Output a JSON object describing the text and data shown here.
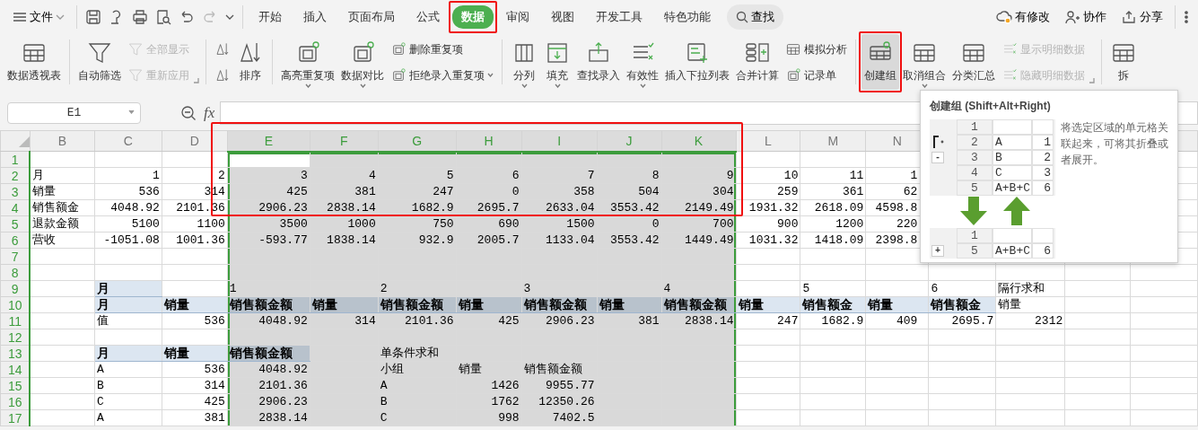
{
  "menu": {
    "label": "文件"
  },
  "tabs": [
    {
      "label": "开始",
      "selected": false
    },
    {
      "label": "插入",
      "selected": false
    },
    {
      "label": "页面布局",
      "selected": false
    },
    {
      "label": "公式",
      "selected": false
    },
    {
      "label": "数据",
      "selected": true
    },
    {
      "label": "审阅",
      "selected": false
    },
    {
      "label": "视图",
      "selected": false
    },
    {
      "label": "开发工具",
      "selected": false
    },
    {
      "label": "特色功能",
      "selected": false
    }
  ],
  "search": {
    "label": "查找"
  },
  "actions": [
    {
      "label": "有修改"
    },
    {
      "label": "协作"
    },
    {
      "label": "分享"
    }
  ],
  "ribbon": {
    "groups": [
      {
        "launcher": false,
        "items": [
          {
            "label": "数据透视表",
            "kind": "large",
            "menu": false,
            "disabled": false,
            "pressed": false
          }
        ]
      },
      {
        "launcher": true,
        "items": [
          {
            "label": "自动筛选",
            "kind": "large",
            "menu": false,
            "disabled": false,
            "pressed": false
          },
          {
            "label": "全部显示",
            "kind": "small",
            "menu": false,
            "disabled": true,
            "pressed": false
          },
          {
            "label": "重新应用",
            "kind": "small",
            "menu": false,
            "disabled": true,
            "pressed": false
          }
        ]
      },
      {
        "launcher": false,
        "items": [
          {
            "kind": "icon",
            "menu": false,
            "disabled": false,
            "pressed": false
          },
          {
            "kind": "icon",
            "menu": false,
            "disabled": false,
            "pressed": false
          },
          {
            "label": "排序",
            "kind": "large",
            "menu": false,
            "disabled": false,
            "pressed": false
          }
        ]
      },
      {
        "launcher": false,
        "items": [
          {
            "label": "高亮重复项",
            "kind": "large",
            "menu": true,
            "disabled": false,
            "pressed": false
          },
          {
            "label": "数据对比",
            "kind": "large",
            "menu": true,
            "disabled": false,
            "pressed": false
          },
          {
            "label": "删除重复项",
            "kind": "small",
            "menu": false,
            "disabled": false,
            "pressed": false
          },
          {
            "label": "拒绝录入重复项",
            "kind": "small",
            "menu": true,
            "disabled": false,
            "pressed": false
          }
        ]
      },
      {
        "launcher": false,
        "items": [
          {
            "label": "分列",
            "kind": "large",
            "menu": true,
            "disabled": false,
            "pressed": false
          },
          {
            "label": "填充",
            "kind": "large",
            "menu": true,
            "disabled": false,
            "pressed": false
          },
          {
            "label": "查找录入",
            "kind": "large",
            "menu": false,
            "disabled": false,
            "pressed": false
          },
          {
            "label": "有效性",
            "kind": "large",
            "menu": true,
            "disabled": false,
            "pressed": false
          },
          {
            "label": "插入下拉列表",
            "kind": "large",
            "menu": false,
            "disabled": false,
            "pressed": false
          },
          {
            "label": "合并计算",
            "kind": "large",
            "menu": false,
            "disabled": false,
            "pressed": false
          },
          {
            "label": "模拟分析",
            "kind": "small",
            "menu": false,
            "disabled": false,
            "pressed": false
          },
          {
            "label": "记录单",
            "kind": "small",
            "menu": false,
            "disabled": false,
            "pressed": false
          }
        ]
      },
      {
        "launcher": true,
        "items": [
          {
            "label": "创建组",
            "kind": "large",
            "menu": false,
            "disabled": false,
            "pressed": true
          },
          {
            "label": "取消组合",
            "kind": "large",
            "menu": true,
            "disabled": false,
            "pressed": false
          },
          {
            "label": "分类汇总",
            "kind": "large",
            "menu": false,
            "disabled": false,
            "pressed": false
          },
          {
            "label": "显示明细数据",
            "kind": "small",
            "menu": false,
            "disabled": true,
            "pressed": false
          },
          {
            "label": "隐藏明细数据",
            "kind": "small",
            "menu": false,
            "disabled": true,
            "pressed": false
          }
        ]
      },
      {
        "launcher": false,
        "items": [
          {
            "label": "拆",
            "kind": "large",
            "menu": false,
            "disabled": false,
            "pressed": false
          }
        ]
      }
    ]
  },
  "formula_bar": {
    "cell_name": "E1",
    "fx_label": "fx"
  },
  "sheet": {
    "columns": [
      {
        "letter": "B",
        "selected": false
      },
      {
        "letter": "C",
        "selected": false
      },
      {
        "letter": "D",
        "selected": false
      },
      {
        "letter": "E",
        "selected": true
      },
      {
        "letter": "F",
        "selected": true
      },
      {
        "letter": "G",
        "selected": true
      },
      {
        "letter": "H",
        "selected": true
      },
      {
        "letter": "I",
        "selected": true
      },
      {
        "letter": "J",
        "selected": true
      },
      {
        "letter": "K",
        "selected": true
      },
      {
        "letter": "L",
        "selected": false
      },
      {
        "letter": "M",
        "selected": false
      },
      {
        "letter": "N",
        "selected": false
      }
    ],
    "rows": [
      {
        "num": "1",
        "cells": [
          {
            "kind": "blank"
          },
          {
            "kind": "blank"
          },
          {
            "kind": "blank"
          },
          {
            "kind": "active"
          }
        ]
      },
      {
        "num": "2",
        "cells": [
          {
            "kind": "text",
            "text": "月"
          },
          {
            "kind": "num",
            "text": "1"
          },
          {
            "kind": "num",
            "text": "2"
          },
          {
            "kind": "num",
            "text": "3"
          },
          {
            "kind": "num",
            "text": "4"
          },
          {
            "kind": "num",
            "text": "5"
          },
          {
            "kind": "num",
            "text": "6"
          },
          {
            "kind": "num",
            "text": "7"
          },
          {
            "kind": "num",
            "text": "8"
          },
          {
            "kind": "num",
            "text": "9"
          },
          {
            "kind": "num",
            "text": "10"
          },
          {
            "kind": "num",
            "text": "11"
          },
          {
            "kind": "num",
            "text": "1"
          }
        ]
      },
      {
        "num": "3",
        "cells": [
          {
            "kind": "text",
            "text": "销量"
          },
          {
            "kind": "num",
            "text": "536"
          },
          {
            "kind": "num",
            "text": "314"
          },
          {
            "kind": "num",
            "text": "425"
          },
          {
            "kind": "num",
            "text": "381"
          },
          {
            "kind": "num",
            "text": "247"
          },
          {
            "kind": "num",
            "text": "0"
          },
          {
            "kind": "num",
            "text": "358"
          },
          {
            "kind": "num",
            "text": "504"
          },
          {
            "kind": "num",
            "text": "304"
          },
          {
            "kind": "num",
            "text": "259"
          },
          {
            "kind": "num",
            "text": "361"
          },
          {
            "kind": "num",
            "text": "62"
          }
        ]
      },
      {
        "num": "4",
        "cells": [
          {
            "kind": "text",
            "text": "销售额金"
          },
          {
            "kind": "num",
            "text": "4048.92"
          },
          {
            "kind": "num",
            "text": "2101.36"
          },
          {
            "kind": "num",
            "text": "2906.23"
          },
          {
            "kind": "num",
            "text": "2838.14"
          },
          {
            "kind": "num",
            "text": "1682.9"
          },
          {
            "kind": "num",
            "text": "2695.7"
          },
          {
            "kind": "num",
            "text": "2633.04"
          },
          {
            "kind": "num",
            "text": "3553.42"
          },
          {
            "kind": "num",
            "text": "2149.49"
          },
          {
            "kind": "num",
            "text": "1931.32"
          },
          {
            "kind": "num",
            "text": "2618.09"
          },
          {
            "kind": "num",
            "text": "4598.8"
          }
        ]
      },
      {
        "num": "5",
        "cells": [
          {
            "kind": "text",
            "text": "退款金额"
          },
          {
            "kind": "num",
            "text": "5100"
          },
          {
            "kind": "num",
            "text": "1100"
          },
          {
            "kind": "num",
            "text": "3500"
          },
          {
            "kind": "num",
            "text": "1000"
          },
          {
            "kind": "num",
            "text": "750"
          },
          {
            "kind": "num",
            "text": "690"
          },
          {
            "kind": "num",
            "text": "1500"
          },
          {
            "kind": "num",
            "text": "0"
          },
          {
            "kind": "num",
            "text": "700"
          },
          {
            "kind": "num",
            "text": "900"
          },
          {
            "kind": "num",
            "text": "1200"
          },
          {
            "kind": "num",
            "text": "220"
          }
        ]
      },
      {
        "num": "6",
        "cells": [
          {
            "kind": "text",
            "text": "营收"
          },
          {
            "kind": "num",
            "text": "-1051.08"
          },
          {
            "kind": "num",
            "text": "1001.36"
          },
          {
            "kind": "num",
            "text": "-593.77"
          },
          {
            "kind": "num",
            "text": "1838.14"
          },
          {
            "kind": "num",
            "text": "932.9"
          },
          {
            "kind": "num",
            "text": "2005.7"
          },
          {
            "kind": "num",
            "text": "1133.04"
          },
          {
            "kind": "num",
            "text": "3553.42"
          },
          {
            "kind": "num",
            "text": "1449.49"
          },
          {
            "kind": "num",
            "text": "1031.32"
          },
          {
            "kind": "num",
            "text": "1418.09"
          },
          {
            "kind": "num",
            "text": "2398.8"
          }
        ]
      },
      {
        "num": "7"
      },
      {
        "num": "8"
      },
      {
        "num": "9",
        "cells": [
          {
            "kind": "blank"
          },
          {
            "kind": "head",
            "text": "月"
          },
          {
            "kind": "blank"
          },
          {
            "kind": "text",
            "text": "1"
          },
          {
            "kind": "blank"
          },
          {
            "kind": "text",
            "text": "2"
          },
          {
            "kind": "blank"
          },
          {
            "kind": "text",
            "text": "3"
          },
          {
            "kind": "blank"
          },
          {
            "kind": "text",
            "text": "4"
          },
          {
            "kind": "blank"
          },
          {
            "kind": "text",
            "text": "5"
          },
          {
            "kind": "blank"
          },
          {
            "kind": "text",
            "text": "6"
          },
          {
            "kind": "text",
            "text": "隔行求和"
          }
        ]
      },
      {
        "num": "10",
        "cells": [
          {
            "kind": "blank"
          },
          {
            "kind": "head",
            "text": "月"
          },
          {
            "kind": "head",
            "text": "销量"
          },
          {
            "kind": "head",
            "text": "销售额金额"
          },
          {
            "kind": "head",
            "text": "销量"
          },
          {
            "kind": "head",
            "text": "销售额金额"
          },
          {
            "kind": "head",
            "text": "销量"
          },
          {
            "kind": "head",
            "text": "销售额金额"
          },
          {
            "kind": "head",
            "text": "销量"
          },
          {
            "kind": "head",
            "text": "销售额金额"
          },
          {
            "kind": "head",
            "text": "销量"
          },
          {
            "kind": "head",
            "text": "销售额金"
          },
          {
            "kind": "head",
            "text": "销量"
          },
          {
            "kind": "head",
            "text": "销售额金"
          },
          {
            "kind": "text",
            "text": "销量"
          }
        ]
      },
      {
        "num": "11",
        "cells": [
          {
            "kind": "blank"
          },
          {
            "kind": "text",
            "text": "值"
          },
          {
            "kind": "num",
            "text": "536"
          },
          {
            "kind": "num",
            "text": "4048.92"
          },
          {
            "kind": "num",
            "text": "314"
          },
          {
            "kind": "num",
            "text": "2101.36"
          },
          {
            "kind": "num",
            "text": "425"
          },
          {
            "kind": "num",
            "text": "2906.23"
          },
          {
            "kind": "num",
            "text": "381"
          },
          {
            "kind": "num",
            "text": "2838.14"
          },
          {
            "kind": "num",
            "text": "247"
          },
          {
            "kind": "num",
            "text": "1682.9"
          },
          {
            "kind": "num",
            "text": "409"
          },
          {
            "kind": "num",
            "text": "2695.7"
          },
          {
            "kind": "num",
            "text": "2312"
          }
        ]
      },
      {
        "num": "12"
      },
      {
        "num": "13",
        "cells": [
          {
            "kind": "blank"
          },
          {
            "kind": "head",
            "text": "月"
          },
          {
            "kind": "head",
            "text": "销量"
          },
          {
            "kind": "head",
            "text": "销售额金额"
          },
          {
            "kind": "blank"
          },
          {
            "kind": "text",
            "text": "单条件求和"
          }
        ]
      },
      {
        "num": "14",
        "cells": [
          {
            "kind": "blank"
          },
          {
            "kind": "text",
            "text": "A"
          },
          {
            "kind": "num",
            "text": "536"
          },
          {
            "kind": "num",
            "text": "4048.92"
          },
          {
            "kind": "blank"
          },
          {
            "kind": "text",
            "text": "小组"
          },
          {
            "kind": "text",
            "text": "销量"
          },
          {
            "kind": "text",
            "text": "销售额金额"
          }
        ]
      },
      {
        "num": "15",
        "cells": [
          {
            "kind": "blank"
          },
          {
            "kind": "text",
            "text": "B"
          },
          {
            "kind": "num",
            "text": "314"
          },
          {
            "kind": "num",
            "text": "2101.36"
          },
          {
            "kind": "blank"
          },
          {
            "kind": "text",
            "text": "A"
          },
          {
            "kind": "num",
            "text": "1426"
          },
          {
            "kind": "num",
            "text": "9955.77"
          }
        ]
      },
      {
        "num": "16",
        "cells": [
          {
            "kind": "blank"
          },
          {
            "kind": "text",
            "text": "C"
          },
          {
            "kind": "num",
            "text": "425"
          },
          {
            "kind": "num",
            "text": "2906.23"
          },
          {
            "kind": "blank"
          },
          {
            "kind": "text",
            "text": "B"
          },
          {
            "kind": "num",
            "text": "1762"
          },
          {
            "kind": "num",
            "text": "12350.26"
          }
        ]
      },
      {
        "num": "17",
        "cells": [
          {
            "kind": "blank"
          },
          {
            "kind": "text",
            "text": "A"
          },
          {
            "kind": "num",
            "text": "381"
          },
          {
            "kind": "num",
            "text": "2838.14"
          },
          {
            "kind": "blank"
          },
          {
            "kind": "text",
            "text": "C"
          },
          {
            "kind": "num",
            "text": "998"
          },
          {
            "kind": "num",
            "text": "7402.5"
          }
        ]
      }
    ]
  },
  "tooltip": {
    "title": "创建组 (Shift+Alt+Right)",
    "description": "将选定区域的单元格关联起来，可将其折叠或者展开。",
    "expanded": {
      "toggle": "-",
      "rows": [
        {
          "num": "1"
        },
        {
          "num": "2",
          "label": "A",
          "value": "1"
        },
        {
          "num": "3",
          "label": "B",
          "value": "2"
        },
        {
          "num": "4",
          "label": "C",
          "value": "3"
        },
        {
          "num": "5",
          "label": "A+B+C",
          "value": "6"
        }
      ]
    },
    "collapsed": {
      "toggle": "+",
      "rows": [
        {
          "num": "1"
        },
        {
          "num": "5",
          "label": "A+B+C",
          "value": "6"
        }
      ]
    }
  }
}
